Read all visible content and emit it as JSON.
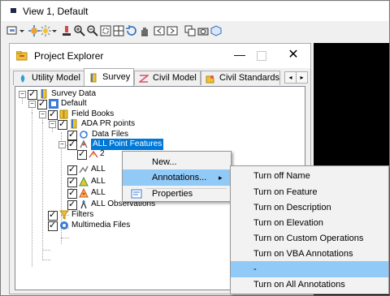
{
  "view_window": {
    "title": "View 1, Default"
  },
  "project_explorer": {
    "title": "Project Explorer",
    "min_glyph": "—",
    "close_glyph": "✕",
    "tabs": [
      {
        "label": "Utility Model"
      },
      {
        "label": "Survey"
      },
      {
        "label": "Civil Model"
      },
      {
        "label": "Civil Standards"
      }
    ],
    "active_tab": "Survey",
    "tab_scroll_left": "◂",
    "tab_scroll_right": "▸"
  },
  "tree": {
    "survey_data": "Survey Data",
    "default": "Default",
    "field_books": "Field Books",
    "ada_pr_points": "ADA PR points",
    "data_files": "Data Files",
    "all_point_features": "ALL Point Features",
    "child_partial": "2",
    "all_1": "ALL",
    "all_2": "ALL",
    "all_3": "ALL",
    "all_observations": "ALL Observations",
    "filters": "Filters",
    "multimedia_files": "Multimedia Files"
  },
  "context_menu": {
    "new": "New...",
    "annotations": "Annotations...",
    "submenu_arrow": "▸",
    "properties": "Properties"
  },
  "annotations_menu": {
    "items": [
      "Turn off Name",
      "Turn on Feature",
      "Turn on Description",
      "Turn on Elevation",
      "Turn on Custom Operations",
      "Turn on VBA Annotations",
      "-",
      "Turn on All Annotations"
    ],
    "highlighted_index": 6
  },
  "colors": {
    "selection": "#0078d7",
    "menu_highlight": "#91c9f7",
    "menu_bg": "#f2f2f2"
  }
}
